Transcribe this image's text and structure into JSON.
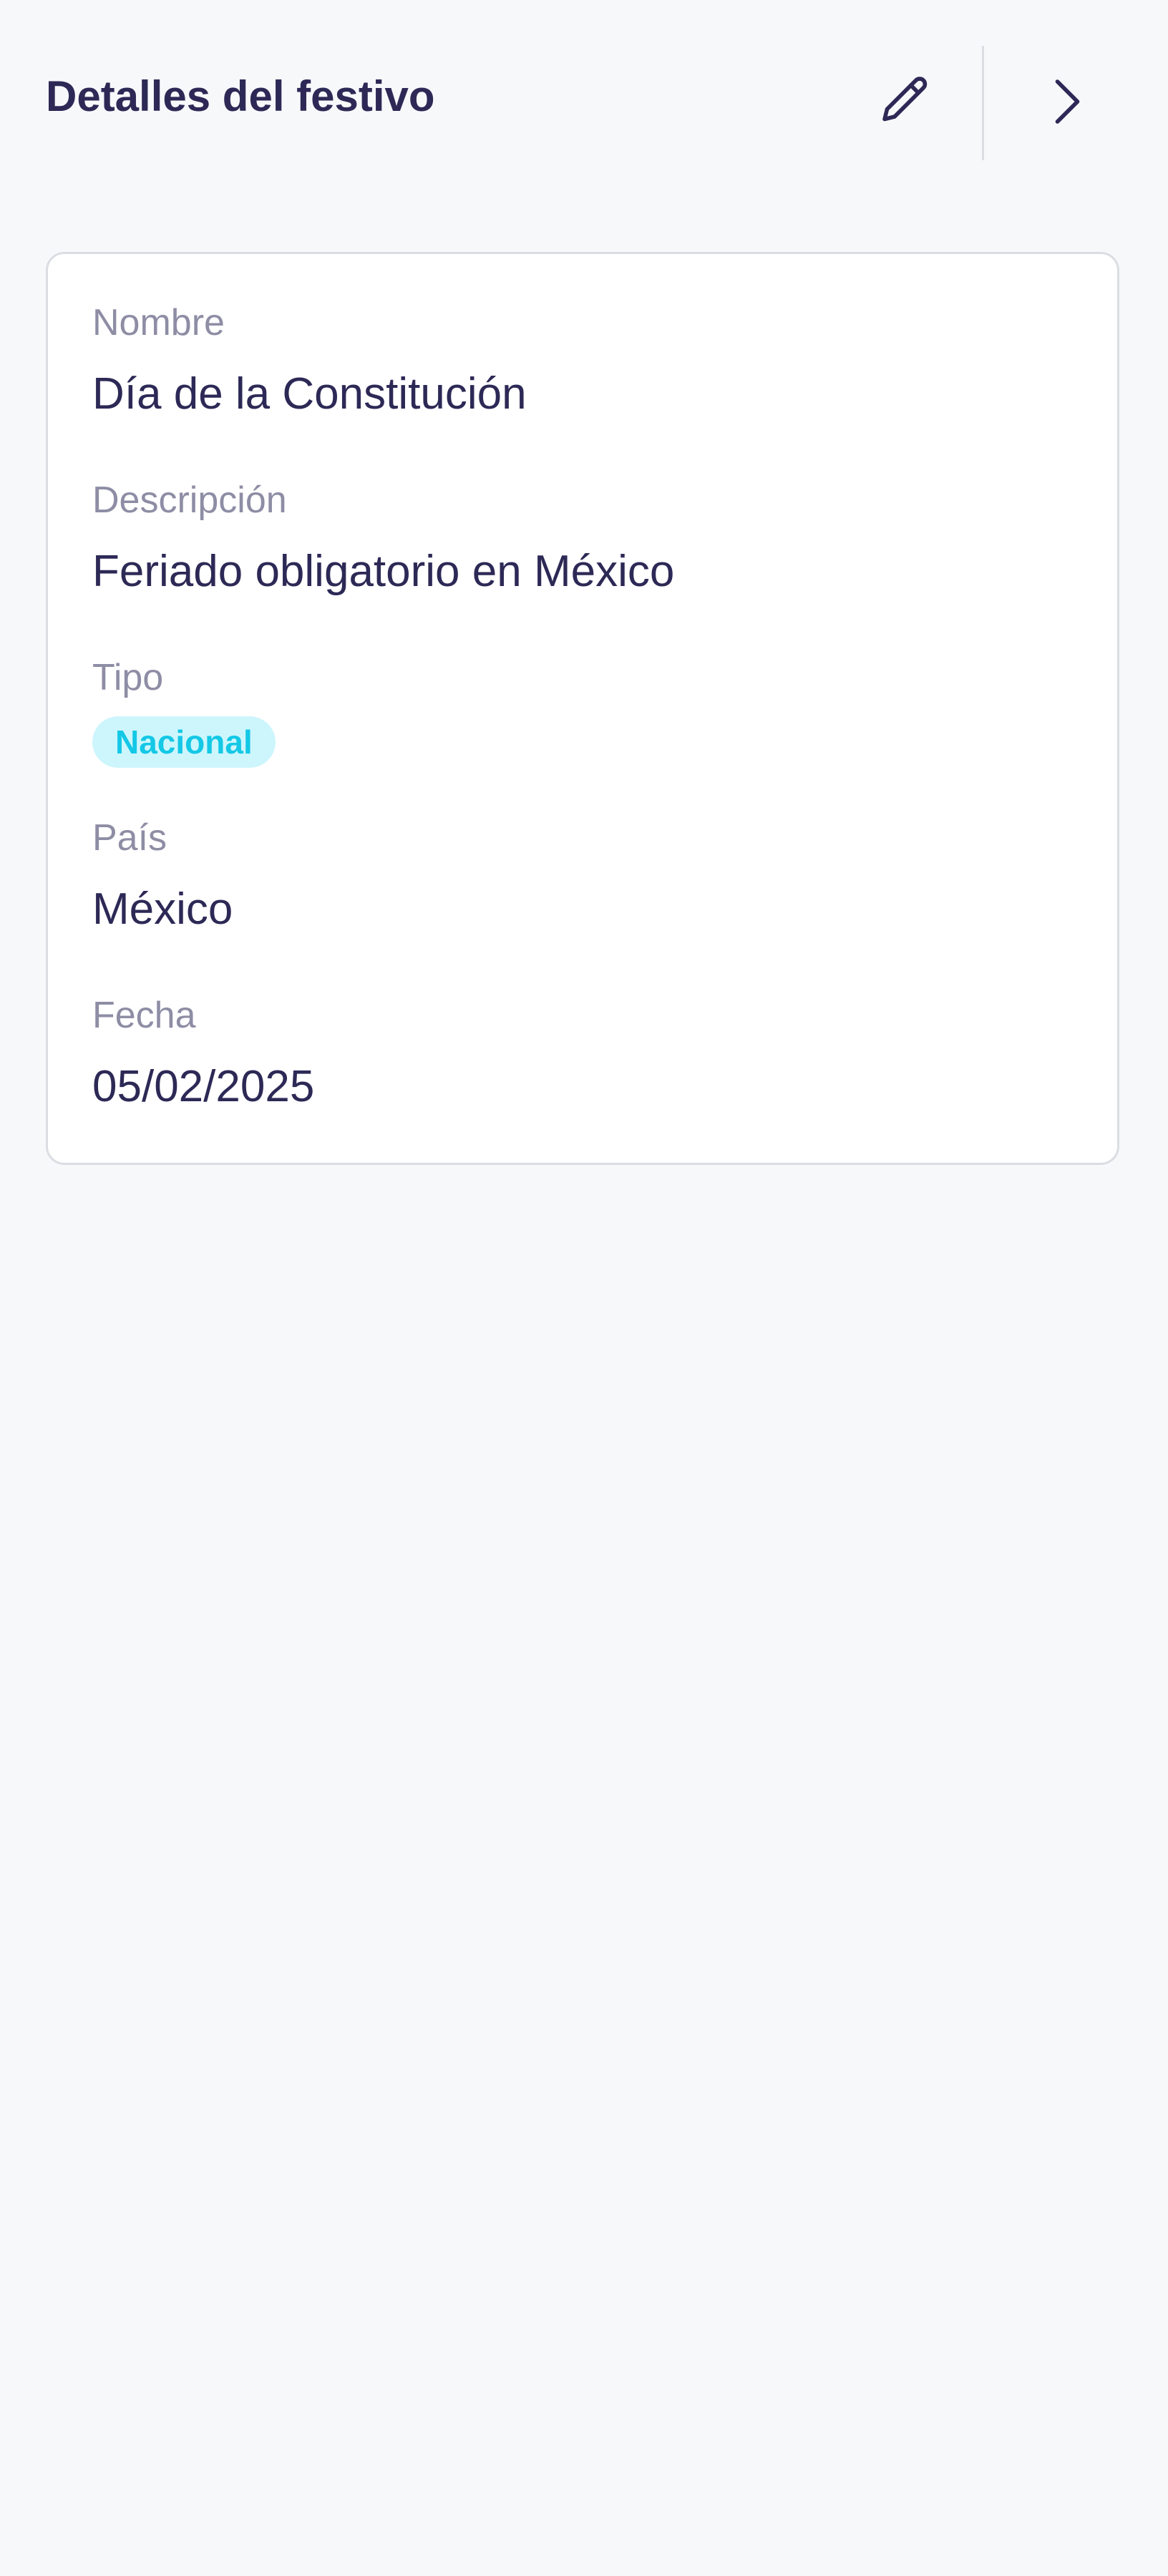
{
  "header": {
    "title": "Detalles del festivo"
  },
  "icons": {
    "edit": "pencil-icon",
    "next": "chevron-right-icon"
  },
  "colors": {
    "text_primary": "#2d2956",
    "text_label": "#8e8da5",
    "badge_bg": "#cdf6fc",
    "badge_text": "#14c8e6",
    "background": "#f7f8fa",
    "card_border": "#dcdde3"
  },
  "details": {
    "name_label": "Nombre",
    "name_value": "Día de la Constitución",
    "description_label": "Descripción",
    "description_value": "Feriado obligatorio en México",
    "type_label": "Tipo",
    "type_value": "Nacional",
    "country_label": "País",
    "country_value": "México",
    "date_label": "Fecha",
    "date_value": "05/02/2025"
  }
}
